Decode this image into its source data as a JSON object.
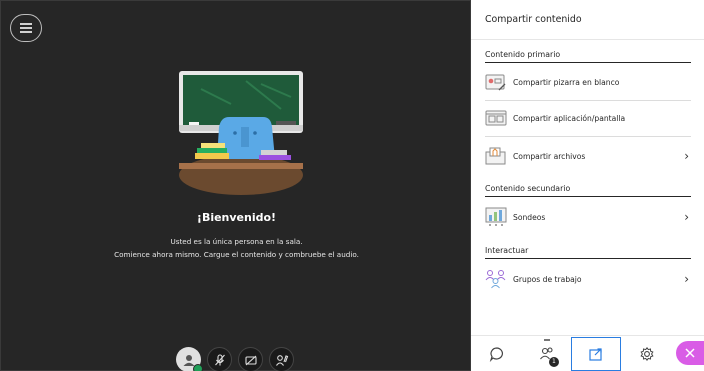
{
  "stage": {
    "welcome_title": "¡Bienvenido!",
    "welcome_line1": "Usted es la única persona en la sala.",
    "welcome_line2": "Comience ahora mismo. Cargue el contenido y combruebe el audio."
  },
  "panel": {
    "title": "Compartir contenido",
    "sections": {
      "primary": "Contenido primario",
      "secondary": "Contenido secundario",
      "interact": "Interactuar"
    },
    "items": {
      "whiteboard": "Compartir pizarra en blanco",
      "app_screen": "Compartir aplicación/pantalla",
      "files": "Compartir archivos",
      "polls": "Sondeos",
      "breakout": "Grupos de trabajo"
    }
  },
  "bottom_bar": {
    "attendees_count": "1"
  },
  "colors": {
    "accent": "#2a7de1",
    "close": "#d95ce6",
    "online": "#1f9e57",
    "stage_bg": "#262626"
  }
}
